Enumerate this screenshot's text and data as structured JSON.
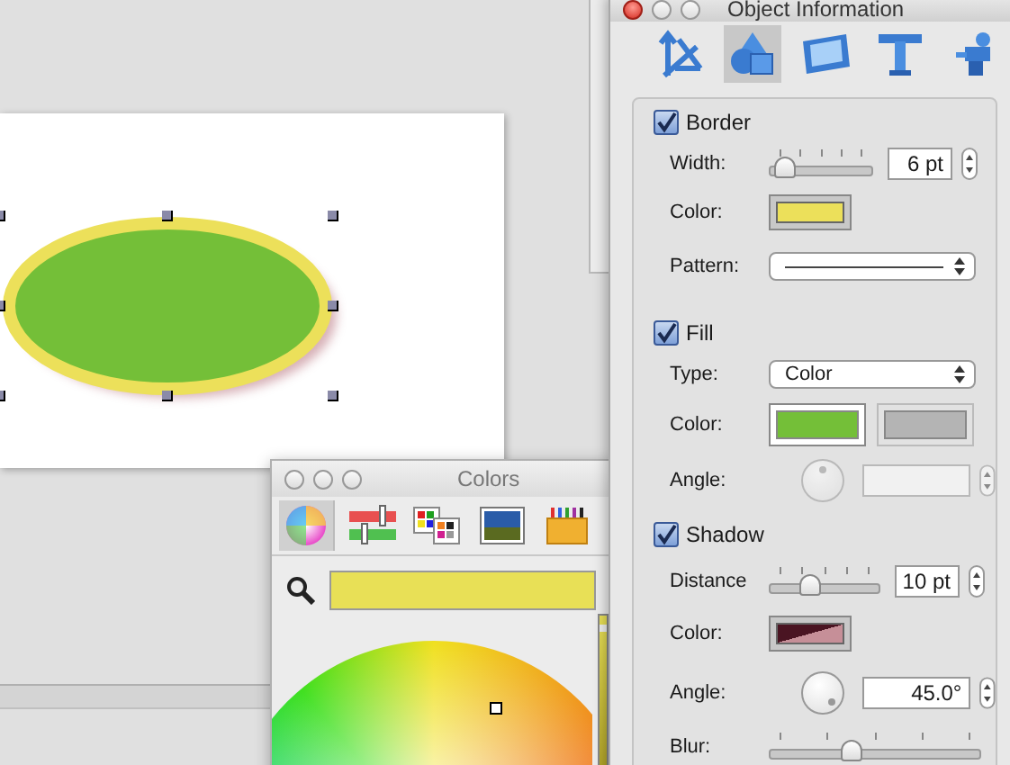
{
  "inspector": {
    "title": "Object Information",
    "tabs": [
      {
        "kind": "axes",
        "selected": false
      },
      {
        "kind": "shapes",
        "selected": true
      },
      {
        "kind": "frame",
        "selected": false
      },
      {
        "kind": "text",
        "selected": false
      },
      {
        "kind": "figure",
        "selected": false
      }
    ],
    "border": {
      "label": "Border",
      "checked": true,
      "width_label": "Width:",
      "width_slider": {
        "level": 0.08
      },
      "width_value": "6 pt",
      "color_label": "Color:",
      "color": "#ece05a",
      "pattern_label": "Pattern:"
    },
    "fill": {
      "label": "Fill",
      "checked": true,
      "type_label": "Type:",
      "type_value": "Color",
      "color_label": "Color:",
      "swatches": [
        {
          "color": "#74bf38",
          "selected": true
        },
        {
          "color": "#b4b4b4",
          "selected": false
        }
      ],
      "angle_label": "Angle:",
      "angle_disabled": true
    },
    "shadow": {
      "label": "Shadow",
      "checked": true,
      "distance_label": "Distance",
      "distance_slider": {
        "level": 0.3
      },
      "distance_value": "10 pt",
      "color_label": "Color:",
      "color": "#c68f98",
      "angle_label": "Angle:",
      "angle_value": "45.0°",
      "blur_label": "Blur:",
      "blur_slider": {
        "level": 0.36
      }
    }
  },
  "colors": {
    "title": "Colors",
    "tabs": [
      {
        "kind": "wheel",
        "selected": true
      },
      {
        "kind": "sliders",
        "selected": false
      },
      {
        "kind": "palettes",
        "selected": false
      },
      {
        "kind": "image",
        "selected": false
      },
      {
        "kind": "crayons",
        "selected": false
      }
    ],
    "swatch": {
      "color": "#e8e056"
    },
    "brightness": {
      "level": 0.95
    }
  }
}
